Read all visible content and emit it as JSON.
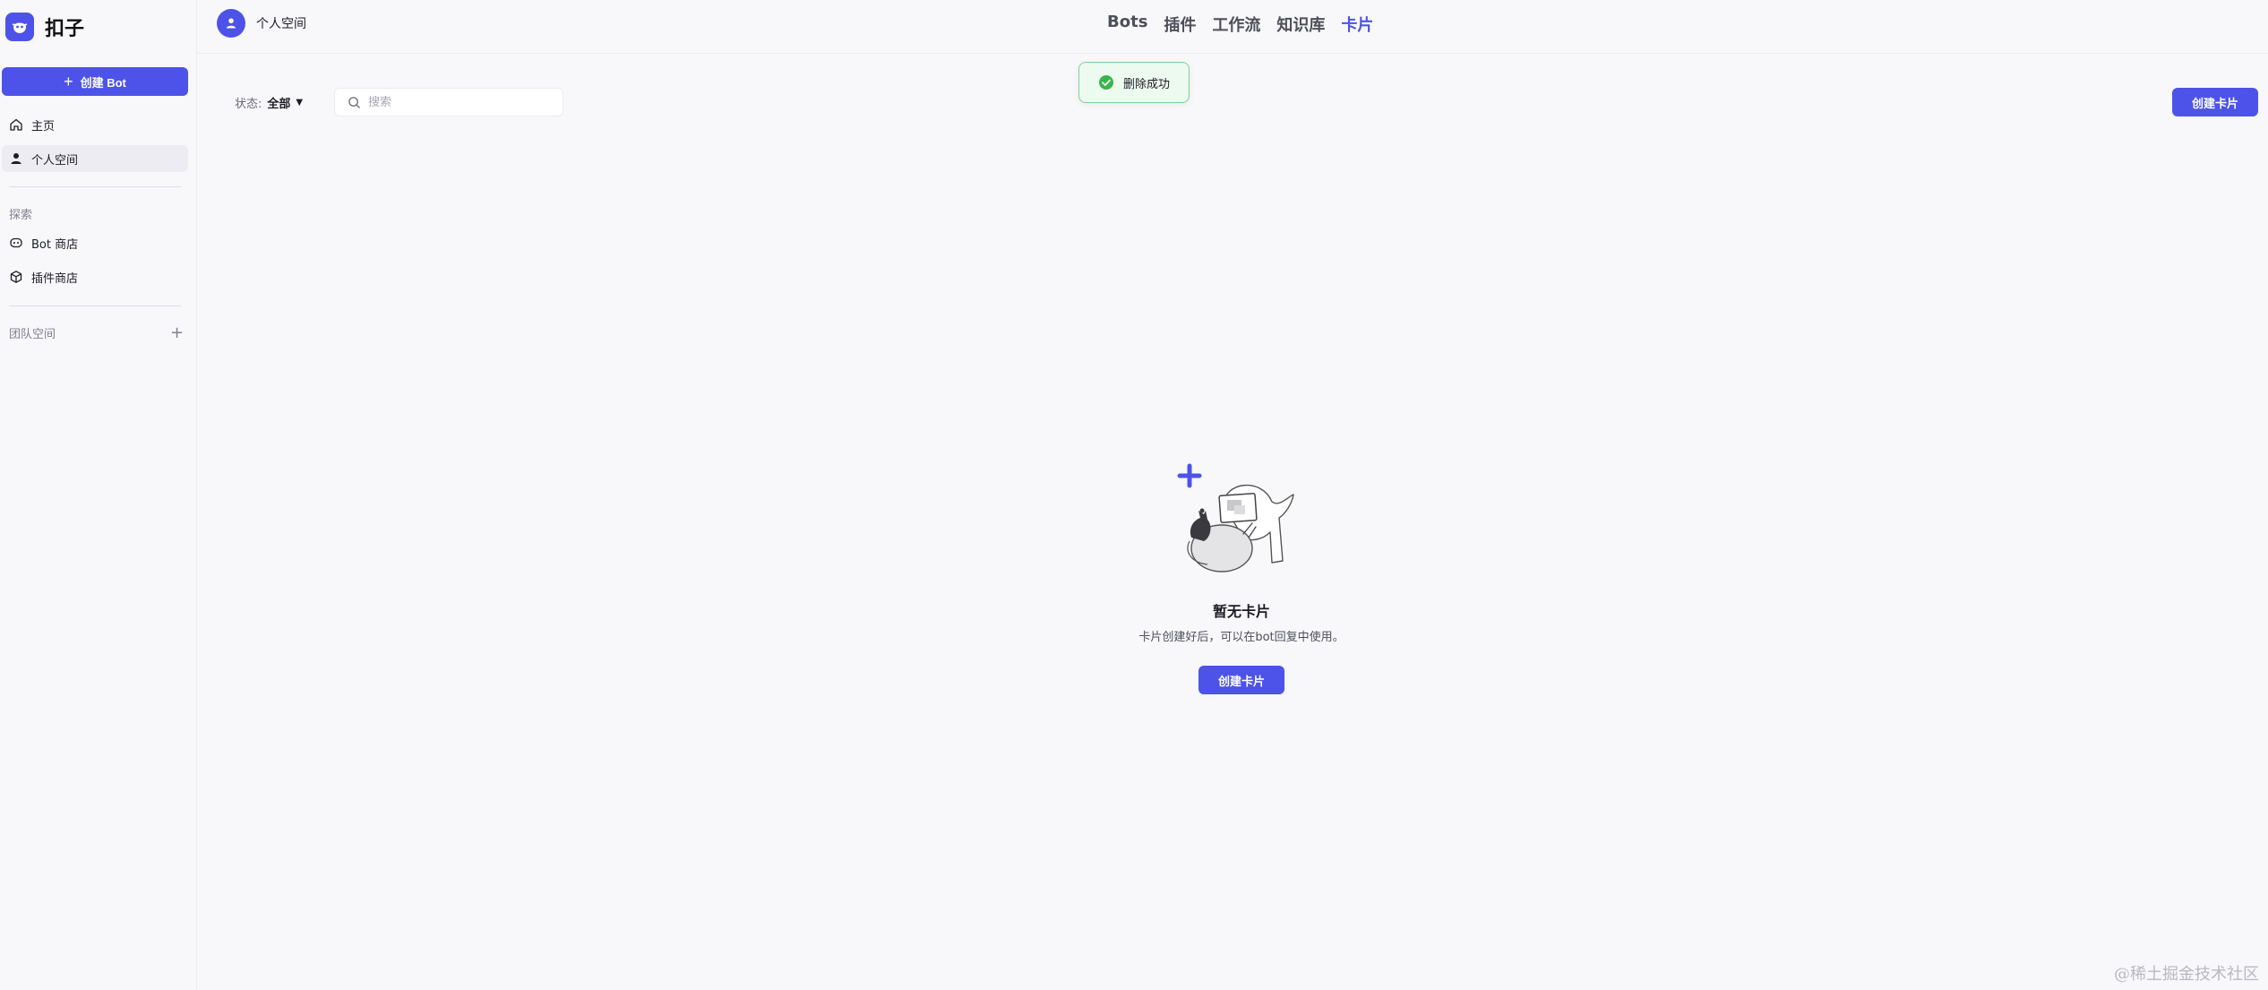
{
  "brand": {
    "name": "扣子",
    "accent": "#4d53e8"
  },
  "sidebar": {
    "create_label": "创建 Bot",
    "items": [
      {
        "label": "主页",
        "icon": "home-icon"
      },
      {
        "label": "个人空间",
        "icon": "user-icon",
        "active": true
      }
    ],
    "explore_label": "探索",
    "explore_items": [
      {
        "label": "Bot 商店",
        "icon": "bot-icon"
      },
      {
        "label": "插件商店",
        "icon": "cube-icon"
      }
    ],
    "team_label": "团队空间"
  },
  "header": {
    "space_title": "个人空间",
    "tabs": [
      {
        "label": "Bots"
      },
      {
        "label": "插件"
      },
      {
        "label": "工作流"
      },
      {
        "label": "知识库"
      },
      {
        "label": "卡片",
        "active": true
      }
    ]
  },
  "toast": {
    "text": "删除成功",
    "color": "#39b54a"
  },
  "toolbar": {
    "status_label": "状态:",
    "status_value": "全部",
    "search_placeholder": "搜索",
    "create_card_label": "创建卡片"
  },
  "empty_state": {
    "title": "暂无卡片",
    "description": "卡片创建好后，可以在bot回复中使用。",
    "button_label": "创建卡片"
  },
  "watermark": "@稀土掘金技术社区"
}
